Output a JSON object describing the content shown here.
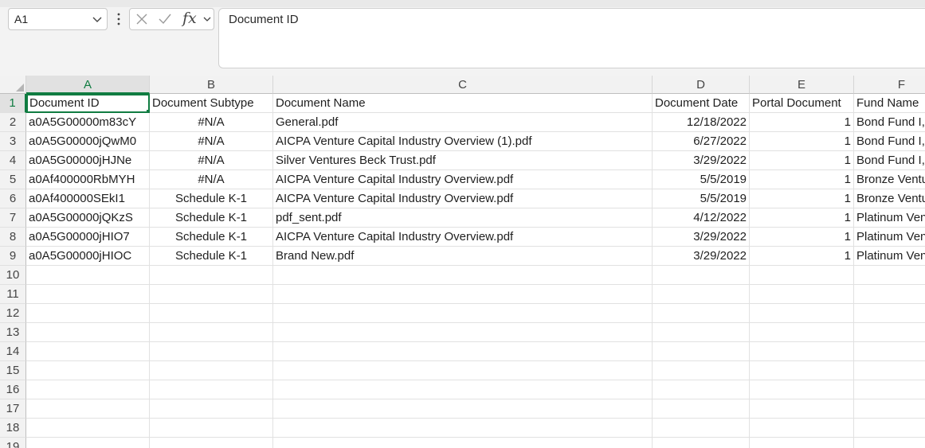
{
  "name_box": {
    "value": "A1"
  },
  "formula_bar": {
    "content": "Document ID",
    "fx_label": "fx"
  },
  "icons": {
    "cancel": "x-icon",
    "confirm": "check-icon",
    "more": "more-vertical-icon",
    "dropdown": "chevron-down-icon"
  },
  "colors": {
    "accent": "#107c41"
  },
  "columns": [
    {
      "letter": "A",
      "selected": true
    },
    {
      "letter": "B"
    },
    {
      "letter": "C"
    },
    {
      "letter": "D"
    },
    {
      "letter": "E"
    },
    {
      "letter": "F"
    }
  ],
  "row_numbers": [
    "1",
    "2",
    "3",
    "4",
    "5",
    "6",
    "7",
    "8",
    "9",
    "10",
    "11",
    "12",
    "13",
    "14",
    "15",
    "16",
    "17",
    "18",
    "19"
  ],
  "headers": [
    "Document ID",
    "Document Subtype",
    "Document Name",
    "Document Date",
    "Portal Document",
    "Fund Name"
  ],
  "rows": [
    [
      "a0A5G00000m83cY",
      "#N/A",
      "General.pdf",
      "12/18/2022",
      "1",
      "Bond Fund I, LP"
    ],
    [
      "a0A5G00000jQwM0",
      "#N/A",
      "AICPA Venture Capital Industry Overview (1).pdf",
      "6/27/2022",
      "1",
      "Bond Fund I, LP"
    ],
    [
      "a0A5G00000jHJNe",
      "#N/A",
      "Silver Ventures Beck Trust.pdf",
      "3/29/2022",
      "1",
      "Bond Fund I, LP"
    ],
    [
      "a0Af400000RbMYH",
      "#N/A",
      "AICPA Venture Capital Industry Overview.pdf",
      "5/5/2019",
      "1",
      "Bronze Ventures"
    ],
    [
      "a0Af400000SEkI1",
      "Schedule K-1",
      "AICPA Venture Capital Industry Overview.pdf",
      "5/5/2019",
      "1",
      "Bronze Ventures"
    ],
    [
      "a0A5G00000jQKzS",
      "Schedule K-1",
      "pdf_sent.pdf",
      "4/12/2022",
      "1",
      "Platinum Ventures"
    ],
    [
      "a0A5G00000jHIO7",
      "Schedule K-1",
      "AICPA Venture Capital Industry Overview.pdf",
      "3/29/2022",
      "1",
      "Platinum Ventures"
    ],
    [
      "a0A5G00000jHIOC",
      "Schedule K-1",
      "Brand New.pdf",
      "3/29/2022",
      "1",
      "Platinum Ventures"
    ]
  ]
}
